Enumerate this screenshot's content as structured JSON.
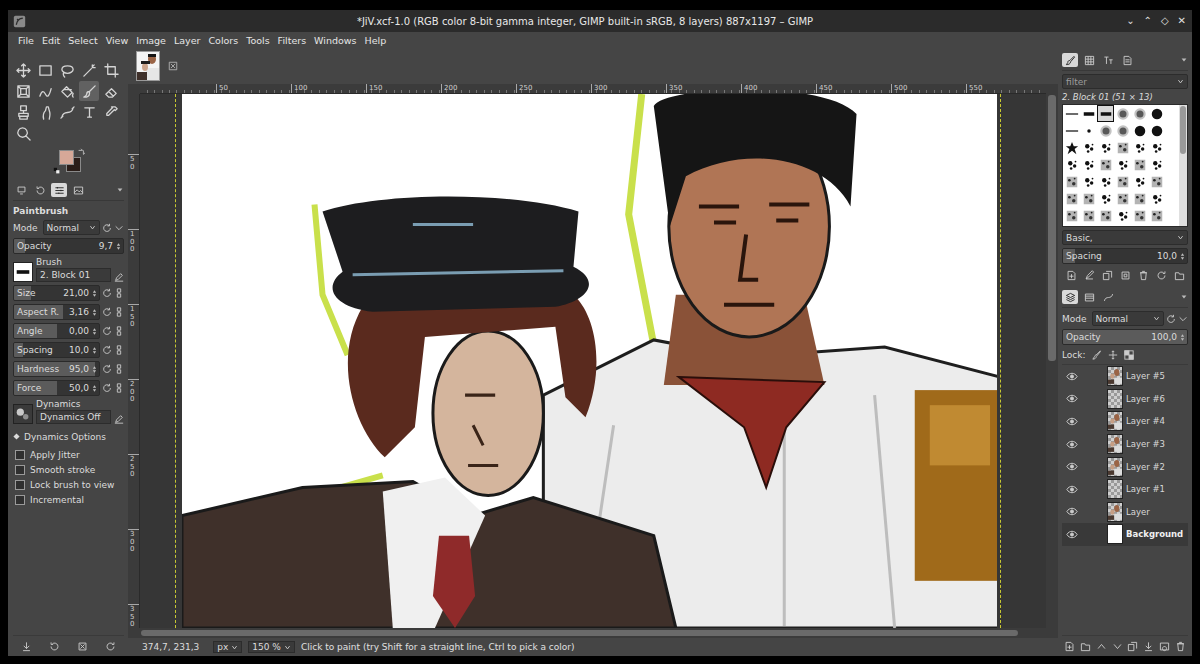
{
  "window": {
    "title": "*JiV.xcf-1.0 (RGB color 8-bit gamma integer, GIMP built-in sRGB, 8 layers) 887x1197 – GIMP",
    "controls": [
      "⌄",
      "⌃",
      "◇",
      "✕"
    ]
  },
  "menu": [
    "File",
    "Edit",
    "Select",
    "View",
    "Image",
    "Layer",
    "Colors",
    "Tools",
    "Filters",
    "Windows",
    "Help"
  ],
  "toolbox": {
    "tools": [
      {
        "kind": "move",
        "selected": false
      },
      {
        "kind": "rect",
        "selected": false
      },
      {
        "kind": "lasso",
        "selected": false
      },
      {
        "kind": "fuzzy",
        "selected": false
      },
      {
        "kind": "crop",
        "selected": false
      },
      {
        "kind": "transform",
        "selected": false
      },
      {
        "kind": "warp",
        "selected": false
      },
      {
        "kind": "bucket",
        "selected": false
      },
      {
        "kind": "paintbrush",
        "selected": true
      },
      {
        "kind": "eraser",
        "selected": false
      },
      {
        "kind": "clone",
        "selected": false
      },
      {
        "kind": "smudge",
        "selected": false
      },
      {
        "kind": "path",
        "selected": false
      },
      {
        "kind": "text",
        "selected": false
      },
      {
        "kind": "picker",
        "selected": false
      },
      {
        "kind": "zoom",
        "selected": false
      }
    ],
    "colors": {
      "foreground": "#d6a898",
      "background": "#2a1d18"
    }
  },
  "tool_options": {
    "tabs": [
      {
        "kind": "device-status",
        "selected": false
      },
      {
        "kind": "undo-history",
        "selected": false
      },
      {
        "kind": "tool-options",
        "selected": true
      },
      {
        "kind": "images",
        "selected": false
      }
    ],
    "title": "Paintbrush",
    "mode": {
      "label": "Mode",
      "value": "Normal"
    },
    "opacity": {
      "label": "Opacity",
      "value": "9,7",
      "level": 0.097
    },
    "brush": {
      "label": "Brush",
      "value": "2. Block 01"
    },
    "sliders": [
      {
        "label": "Size",
        "value": "21,00",
        "level": 0.2
      },
      {
        "label": "Aspect R.",
        "value": "3,16",
        "level": 0.58
      },
      {
        "label": "Angle",
        "value": "0,00",
        "level": 0.5
      },
      {
        "label": "Spacing",
        "value": "10,0",
        "level": 0.1
      },
      {
        "label": "Hardness",
        "value": "95,0",
        "level": 0.95
      },
      {
        "label": "Force",
        "value": "50,0",
        "level": 0.5
      }
    ],
    "dynamics": {
      "label": "Dynamics",
      "value": "Dynamics Off"
    },
    "dynamics_options": {
      "label": "Dynamics Options",
      "expanded": false
    },
    "options": [
      {
        "label": "Apply Jitter",
        "checked": false
      },
      {
        "label": "Smooth stroke",
        "checked": false
      },
      {
        "label": "Lock brush to view",
        "checked": false
      },
      {
        "label": "Incremental",
        "checked": false
      }
    ]
  },
  "rulers": {
    "top": [
      "50",
      "100",
      "150",
      "200",
      "250",
      "300",
      "350",
      "400",
      "450",
      "500",
      "550"
    ],
    "left": [
      "50",
      "100",
      "150",
      "200",
      "250",
      "300",
      "350"
    ]
  },
  "scrollbars": {
    "vertical": {
      "level": 0.5
    },
    "horizontal": {
      "level": 0.97
    }
  },
  "status_bar": {
    "coords": "374,7, 231,3",
    "unit": "px",
    "zoom": "150 %",
    "message": "Click to paint (try Shift for a straight line, Ctrl to pick a color)"
  },
  "brushes": {
    "tabs": [
      {
        "kind": "brushes",
        "selected": true
      },
      {
        "kind": "patterns",
        "selected": false
      },
      {
        "kind": "fonts",
        "selected": false
      },
      {
        "kind": "document-history",
        "selected": false
      }
    ],
    "filter_placeholder": "filter",
    "selected_name": "2. Block 01 (51 × 13)",
    "items": [
      {
        "kind": "line",
        "selected": false
      },
      {
        "kind": "block",
        "selected": false
      },
      {
        "kind": "block",
        "selected": true
      },
      {
        "kind": "soft",
        "selected": false
      },
      {
        "kind": "soft",
        "selected": false
      },
      {
        "kind": "hard",
        "selected": false
      },
      {
        "kind": "line",
        "selected": false
      },
      {
        "kind": "dot",
        "selected": false
      },
      {
        "kind": "soft",
        "selected": false
      },
      {
        "kind": "soft",
        "selected": false
      },
      {
        "kind": "hard",
        "selected": false
      },
      {
        "kind": "hard",
        "selected": false
      },
      {
        "kind": "star",
        "selected": false
      },
      {
        "kind": "splat",
        "selected": false
      },
      {
        "kind": "splat",
        "selected": false
      },
      {
        "kind": "texture",
        "selected": false
      },
      {
        "kind": "splat",
        "selected": false
      },
      {
        "kind": "splat",
        "selected": false
      },
      {
        "kind": "splat",
        "selected": false
      },
      {
        "kind": "splat",
        "selected": false
      },
      {
        "kind": "texture",
        "selected": false
      },
      {
        "kind": "splat",
        "selected": false
      },
      {
        "kind": "texture",
        "selected": false
      },
      {
        "kind": "splat",
        "selected": false
      },
      {
        "kind": "texture",
        "selected": false
      },
      {
        "kind": "splat",
        "selected": false
      },
      {
        "kind": "splat",
        "selected": false
      },
      {
        "kind": "texture",
        "selected": false
      },
      {
        "kind": "splat",
        "selected": false
      },
      {
        "kind": "texture",
        "selected": false
      },
      {
        "kind": "texture",
        "selected": false
      },
      {
        "kind": "texture",
        "selected": false
      },
      {
        "kind": "splat",
        "selected": false
      },
      {
        "kind": "texture",
        "selected": false
      },
      {
        "kind": "texture",
        "selected": false
      },
      {
        "kind": "splat",
        "selected": false
      },
      {
        "kind": "texture",
        "selected": false
      },
      {
        "kind": "texture",
        "selected": false
      },
      {
        "kind": "texture",
        "selected": false
      },
      {
        "kind": "splat",
        "selected": false
      },
      {
        "kind": "texture",
        "selected": false
      },
      {
        "kind": "texture",
        "selected": false
      }
    ],
    "tag": "Basic,",
    "spacing": {
      "label": "Spacing",
      "value": "10,0",
      "level": 0.1
    }
  },
  "layers": {
    "tabs": [
      {
        "kind": "layers",
        "selected": true
      },
      {
        "kind": "channels",
        "selected": false
      },
      {
        "kind": "paths",
        "selected": false
      }
    ],
    "mode": {
      "label": "Mode",
      "value": "Normal"
    },
    "opacity": {
      "label": "Opacity",
      "value": "100,0",
      "level": 1
    },
    "lock_label": "Lock:",
    "items": [
      {
        "name": "Layer #5",
        "visible": true,
        "kind": "painted",
        "selected": false
      },
      {
        "name": "Layer #6",
        "visible": true,
        "kind": "transparent",
        "selected": false
      },
      {
        "name": "Layer #4",
        "visible": true,
        "kind": "painted",
        "selected": false
      },
      {
        "name": "Layer #3",
        "visible": true,
        "kind": "painted",
        "selected": false
      },
      {
        "name": "Layer #2",
        "visible": true,
        "kind": "painted",
        "selected": false
      },
      {
        "name": "Layer #1",
        "visible": true,
        "kind": "transparent",
        "selected": false
      },
      {
        "name": "Layer",
        "visible": true,
        "kind": "painted",
        "selected": false
      },
      {
        "name": "Background",
        "visible": true,
        "kind": "white",
        "selected": true
      }
    ]
  }
}
